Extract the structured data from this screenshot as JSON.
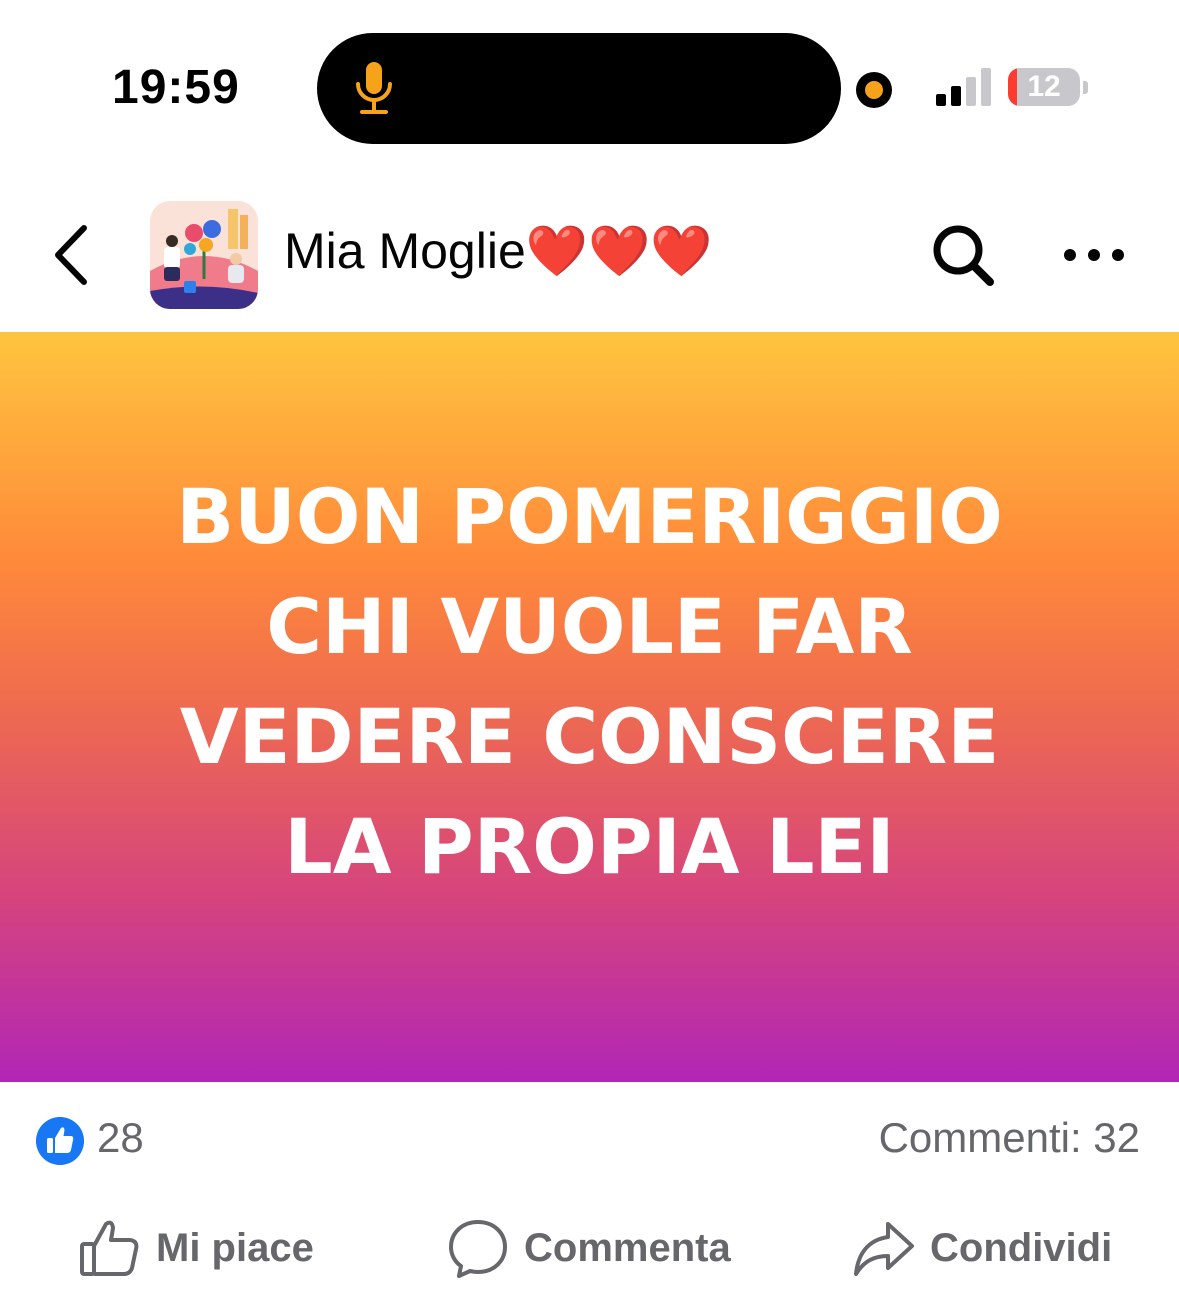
{
  "status_bar": {
    "time": "19:59",
    "battery_level": "12",
    "battery_fraction": 0.12,
    "icons": [
      "microphone-icon",
      "recording-indicator",
      "signal-icon",
      "battery-icon"
    ]
  },
  "header": {
    "title": "Mia Moglie❤️❤️❤️",
    "icons": [
      "back-chevron-icon",
      "group-avatar",
      "search-icon",
      "more-icon"
    ]
  },
  "post": {
    "lines": [
      "BUON POMERIGGIO",
      "CHI VUOLE FAR",
      "VEDERE CONSCERE",
      "LA PROPIA LEI"
    ]
  },
  "reactions": {
    "like_count": "28",
    "comments": "Commenti: 32"
  },
  "actions": {
    "like_label": "Mi piace",
    "comment_label": "Commenta",
    "share_label": "Condividi"
  },
  "colors": {
    "brand_blue": "#1877f2",
    "gradient_top": "#ffc53f",
    "gradient_bottom": "#b126b6",
    "text_secondary": "#65676b"
  }
}
